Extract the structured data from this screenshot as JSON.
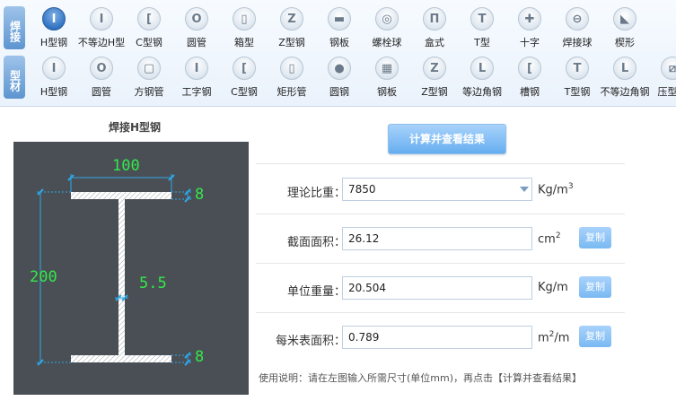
{
  "sidebar_tabs": {
    "welded": "焊接",
    "profile": "型材"
  },
  "welded_tools": [
    {
      "label": "H型钢",
      "glyph": "I",
      "icon": "h-beam-icon",
      "active": true
    },
    {
      "label": "不等边H型",
      "glyph": "I",
      "icon": "unequal-h-beam-icon"
    },
    {
      "label": "C型钢",
      "glyph": "[",
      "icon": "c-channel-icon"
    },
    {
      "label": "圆管",
      "glyph": "O",
      "icon": "round-tube-icon"
    },
    {
      "label": "箱型",
      "glyph": "▯",
      "icon": "box-section-icon"
    },
    {
      "label": "Z型钢",
      "glyph": "Z",
      "icon": "z-section-icon"
    },
    {
      "label": "钢板",
      "glyph": "▬",
      "icon": "steel-plate-icon"
    },
    {
      "label": "螺栓球",
      "glyph": "◎",
      "icon": "bolt-ball-icon"
    },
    {
      "label": "盒式",
      "glyph": "Π",
      "icon": "box-type-icon"
    },
    {
      "label": "T型",
      "glyph": "T",
      "icon": "t-section-icon"
    },
    {
      "label": "十字",
      "glyph": "✚",
      "icon": "cross-section-icon"
    },
    {
      "label": "焊接球",
      "glyph": "⊖",
      "icon": "welded-ball-icon"
    },
    {
      "label": "楔形",
      "glyph": "◣",
      "icon": "wedge-icon"
    }
  ],
  "profile_tools": [
    {
      "label": "H型钢",
      "glyph": "I",
      "icon": "h-beam-icon"
    },
    {
      "label": "圆管",
      "glyph": "O",
      "icon": "round-tube-icon"
    },
    {
      "label": "方钢管",
      "glyph": "▢",
      "icon": "square-tube-icon"
    },
    {
      "label": "工字钢",
      "glyph": "I",
      "icon": "i-beam-icon"
    },
    {
      "label": "C型钢",
      "glyph": "[",
      "icon": "c-channel-icon"
    },
    {
      "label": "矩形管",
      "glyph": "▯",
      "icon": "rect-tube-icon"
    },
    {
      "label": "圆钢",
      "glyph": "●",
      "icon": "round-bar-icon"
    },
    {
      "label": "钢板",
      "glyph": "▦",
      "icon": "steel-plate-icon"
    },
    {
      "label": "Z型钢",
      "glyph": "Z",
      "icon": "z-section-icon"
    },
    {
      "label": "等边角钢",
      "glyph": "L",
      "icon": "equal-angle-icon"
    },
    {
      "label": "槽钢",
      "glyph": "[",
      "icon": "channel-icon"
    },
    {
      "label": "T型钢",
      "glyph": "T",
      "icon": "t-section-icon"
    },
    {
      "label": "不等边角钢",
      "glyph": "L",
      "icon": "unequal-angle-icon"
    },
    {
      "label": "压型钢",
      "glyph": "⧄",
      "icon": "profiled-steel-icon"
    }
  ],
  "diagram": {
    "title": "焊接H型钢",
    "width": "100",
    "height": "200",
    "web": "5.5",
    "flange_top": "8",
    "flange_bottom": "8"
  },
  "calc_button": "计算并查看结果",
  "fields": {
    "density": {
      "label": "理论比重：",
      "value": "7850",
      "unit": "Kg/m",
      "unit_sup": "3"
    },
    "area": {
      "label": "截面面积：",
      "value": "26.12",
      "unit": "cm",
      "unit_sup": "2",
      "copy": "复制"
    },
    "weight": {
      "label": "单位重量：",
      "value": "20.504",
      "unit": "Kg/m",
      "unit_sup": "",
      "copy": "复制"
    },
    "surface": {
      "label": "每米表面积：",
      "value": "0.789",
      "unit": "m",
      "unit_sup": "2",
      "unit_tail": "/m",
      "copy": "复制"
    }
  },
  "usage_text": "使用说明：请在左图输入所需尺寸(单位mm)，再点击【计算并查看结果】"
}
